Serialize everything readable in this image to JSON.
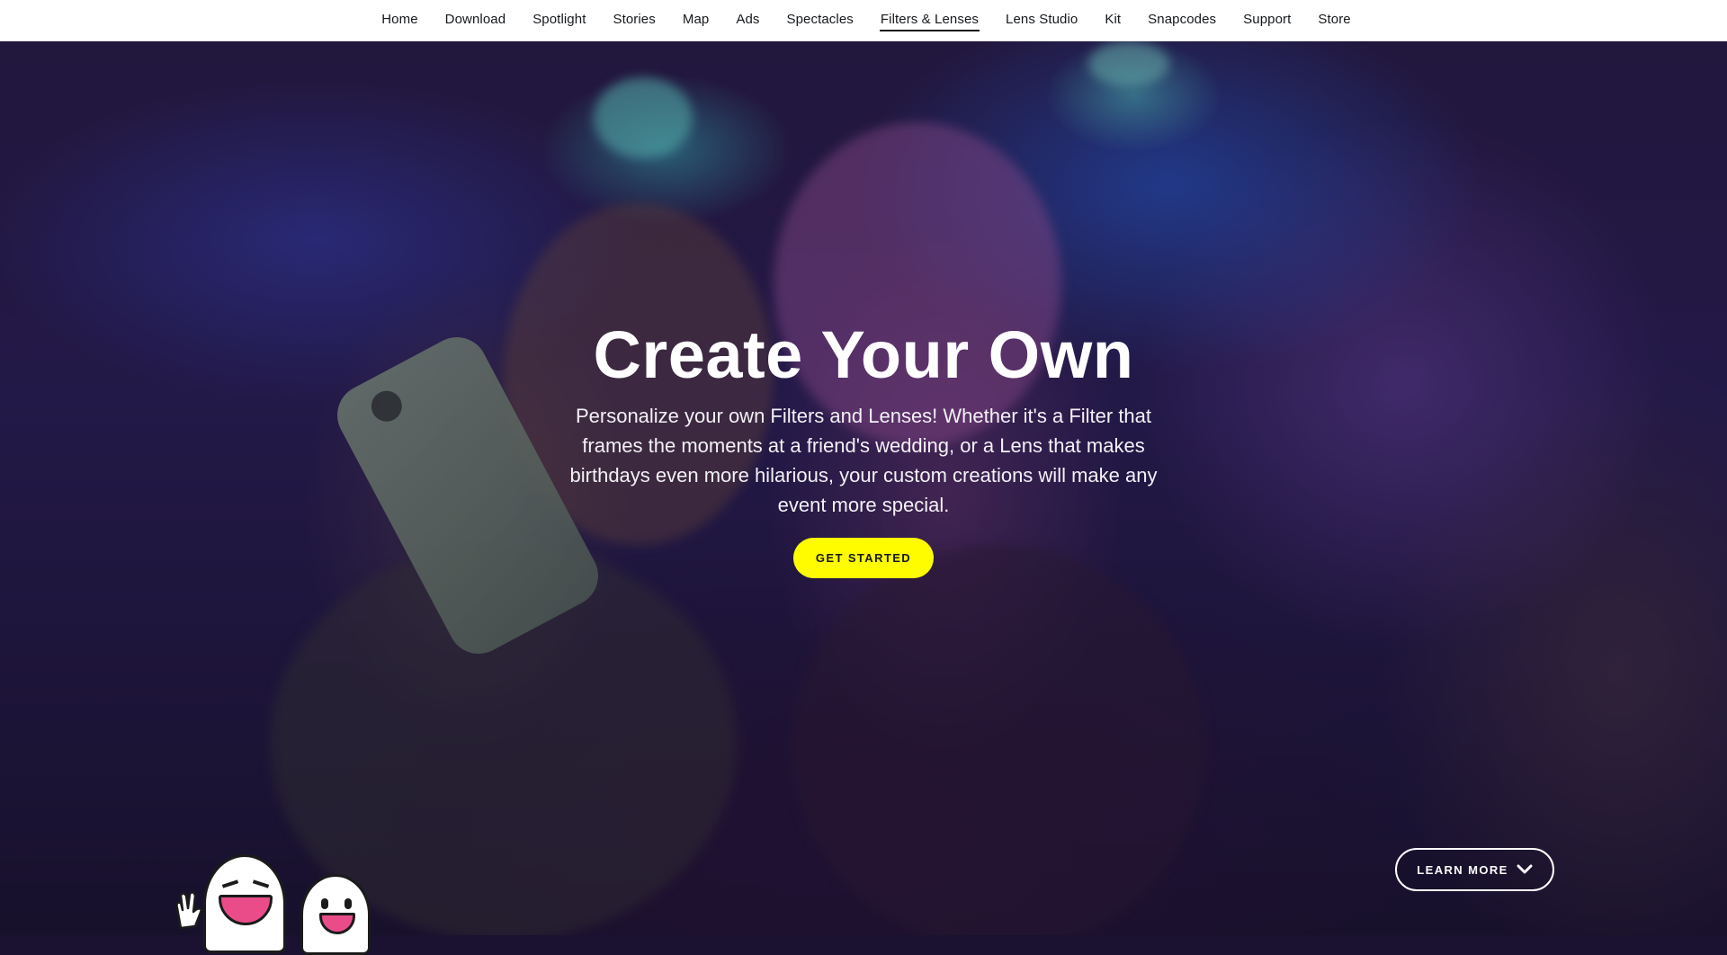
{
  "nav": {
    "items": [
      {
        "label": "Home"
      },
      {
        "label": "Download"
      },
      {
        "label": "Spotlight"
      },
      {
        "label": "Stories"
      },
      {
        "label": "Map"
      },
      {
        "label": "Ads"
      },
      {
        "label": "Spectacles"
      },
      {
        "label": "Filters & Lenses"
      },
      {
        "label": "Lens Studio"
      },
      {
        "label": "Kit"
      },
      {
        "label": "Snapcodes"
      },
      {
        "label": "Support"
      },
      {
        "label": "Store"
      }
    ],
    "active": "Filters & Lenses"
  },
  "hero": {
    "title": "Create Your Own",
    "description": "Personalize your own Filters and Lenses! Whether it's a Filter that frames the moments at a friend's wedding, or a Lens that makes birthdays even more hilarious, your custom creations will make any event more special.",
    "cta_label": "GET STARTED",
    "learn_more_label": "LEARN MORE"
  },
  "colors": {
    "cta_background": "#fffc00",
    "nav_background": "#ffffff",
    "nav_text": "#16191c",
    "ghost_mouth": "#ea4c89"
  },
  "icons": {
    "learn_more": "chevron-down-icon",
    "mascots": "ghost-mascot-icon"
  }
}
